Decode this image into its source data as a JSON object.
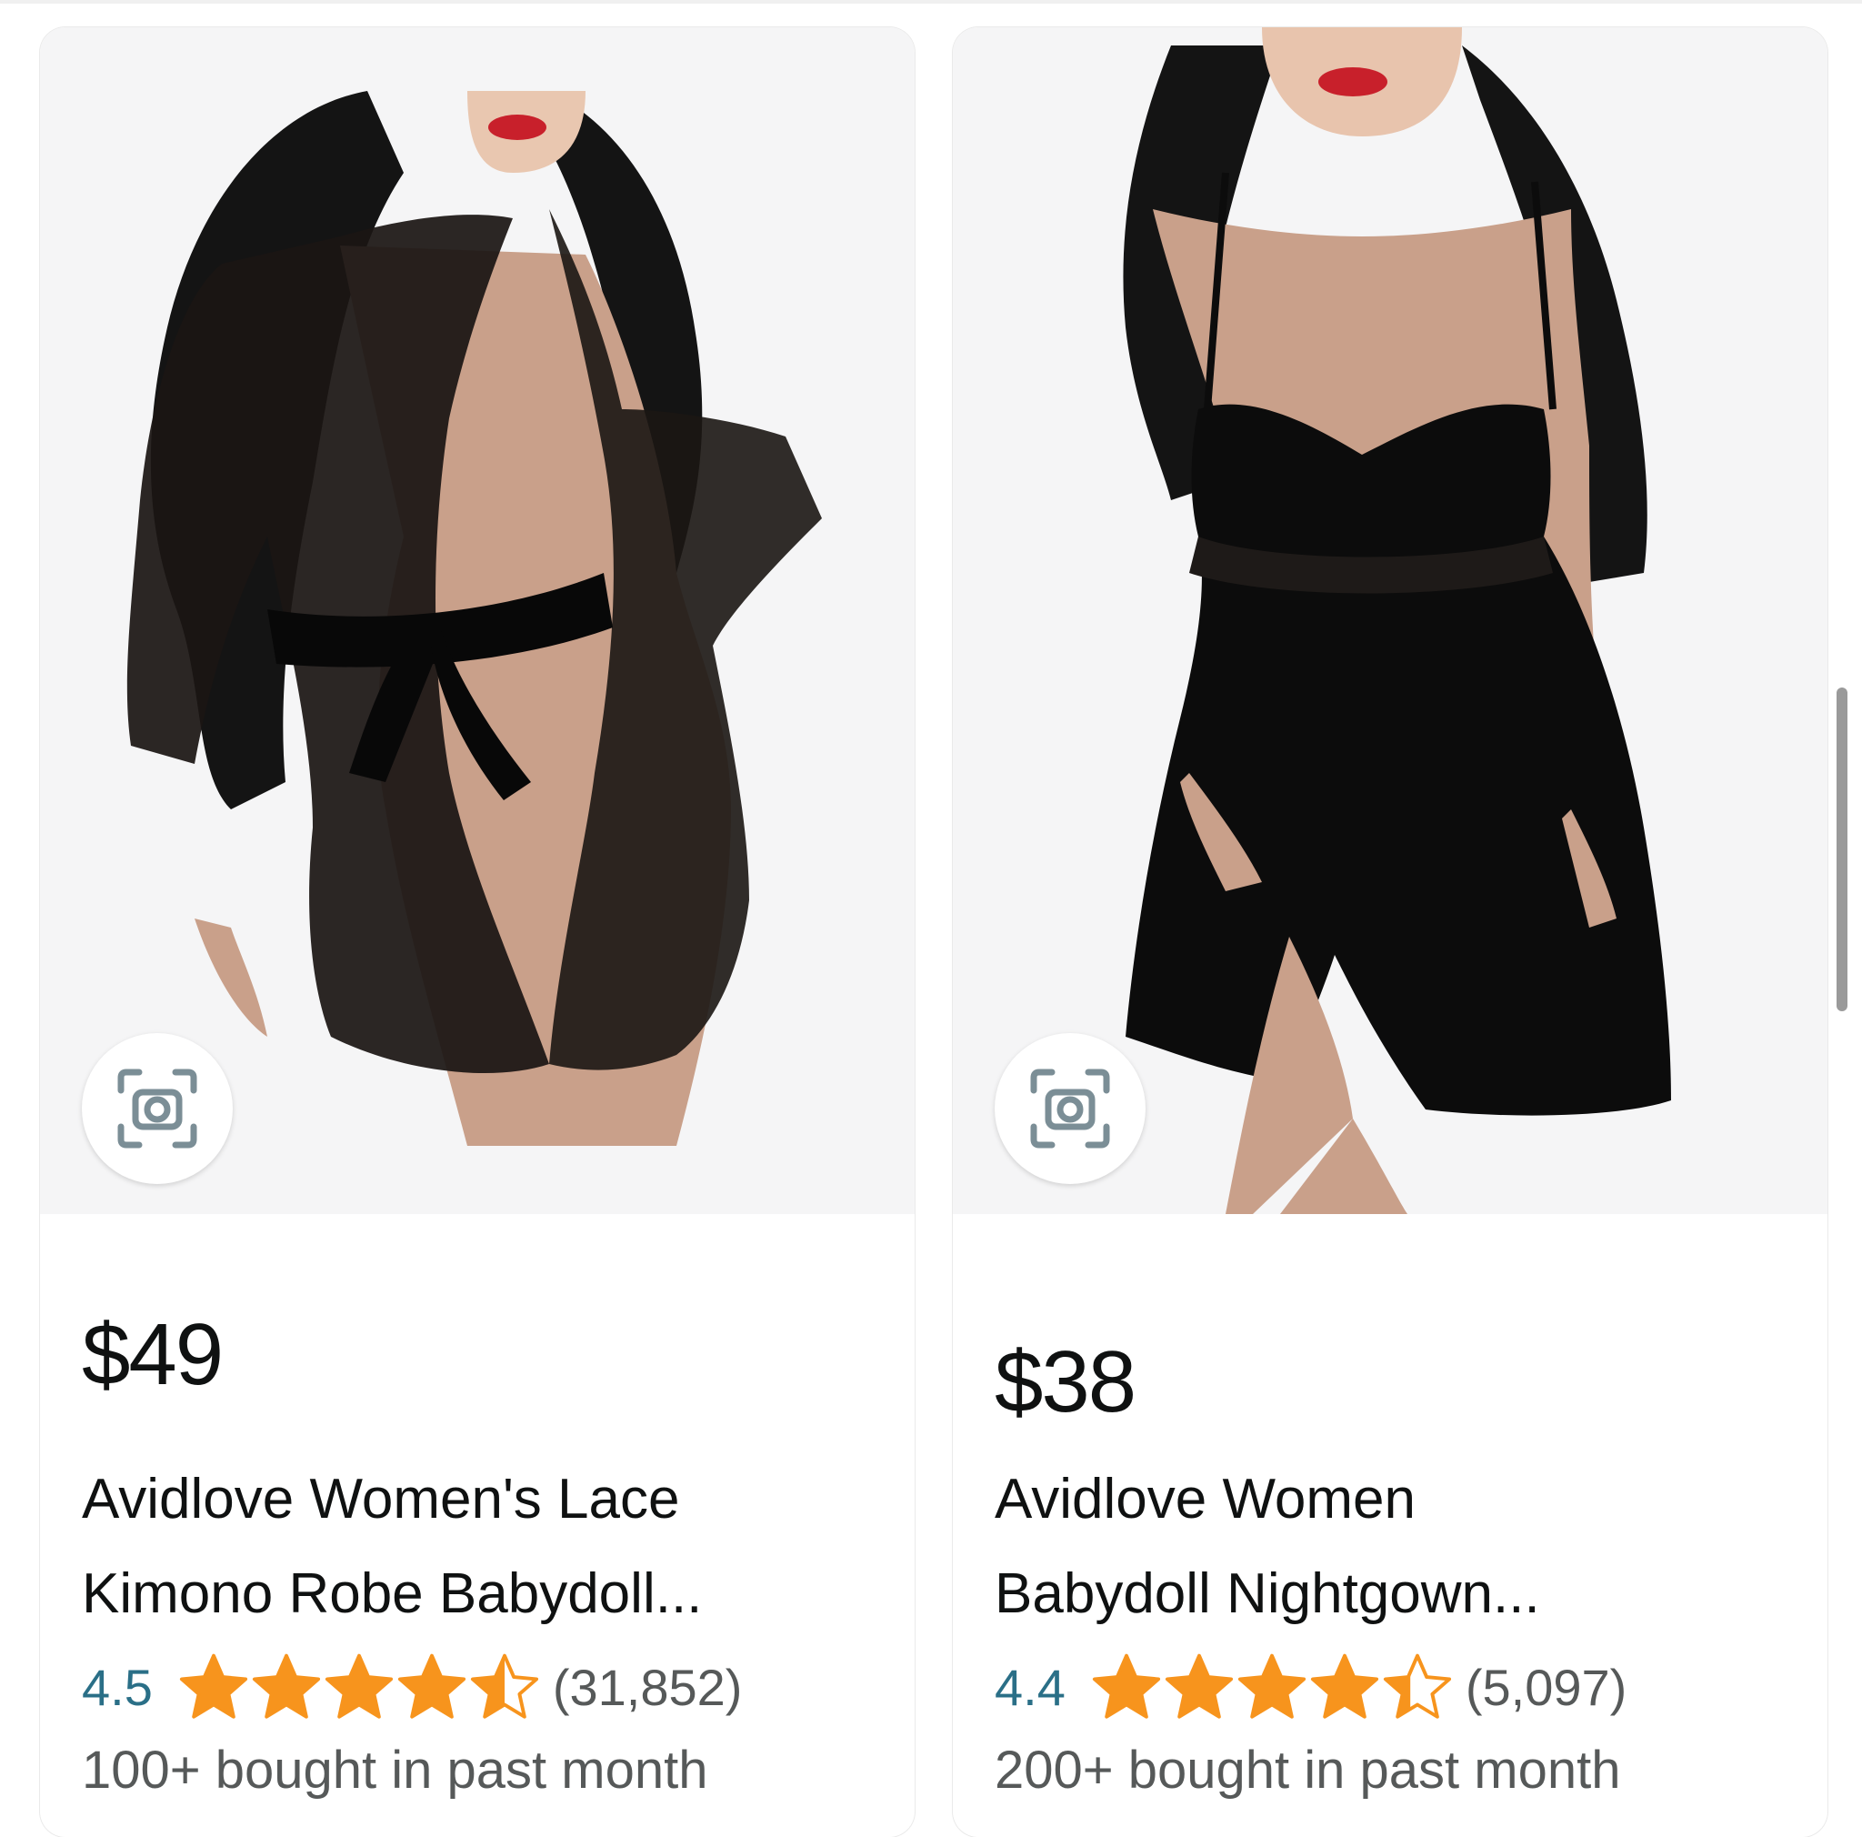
{
  "products": [
    {
      "price": "$49",
      "title_line1": "Avidlove Women's Lace",
      "title_line2": "Kimono Robe Babydoll...",
      "rating": "4.5",
      "rating_value": 4.5,
      "review_count": "(31,852)",
      "bought": "100+ bought in past month",
      "image_icon": "lace-kimono-robe-product-image"
    },
    {
      "price": "$38",
      "title_line1": "Avidlove Women",
      "title_line2": "Babydoll Nightgown...",
      "rating": "4.4",
      "rating_value": 4.4,
      "review_count": "(5,097)",
      "bought": "200+ bought in past month",
      "image_icon": "babydoll-nightgown-product-image"
    }
  ],
  "colors": {
    "star": "#f7941d",
    "rating_text": "#2a6f87",
    "muted_text": "#565959",
    "primary_text": "#0f1111",
    "image_bg": "#f5f5f6"
  },
  "icons": {
    "lens": "camera-lens-icon",
    "star": "star-icon"
  }
}
